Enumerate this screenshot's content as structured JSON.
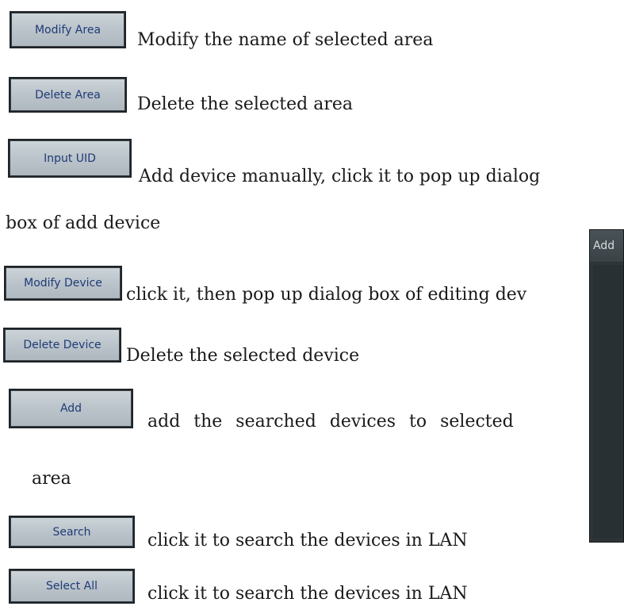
{
  "rows": [
    {
      "button_label": "Modify Area",
      "description": "Modify the name of selected area"
    },
    {
      "button_label": "Delete Area",
      "description": "Delete the selected area"
    },
    {
      "button_label": "Input UID",
      "description": "Add device manually, click it to pop up dialog",
      "description_cont": "box of add device"
    },
    {
      "button_label": "Modify Device",
      "description": "click it, then pop up dialog box of editing dev"
    },
    {
      "button_label": "Delete Device",
      "description": "Delete the selected device"
    },
    {
      "button_label": "Add",
      "description": "add the searched devices to selected",
      "description_cont": "area"
    },
    {
      "button_label": "Search",
      "description": "click it to search the devices in LAN"
    },
    {
      "button_label": "Select All",
      "description": "click it to search the devices in LAN"
    }
  ],
  "side_panel": {
    "header_label": "Add"
  }
}
